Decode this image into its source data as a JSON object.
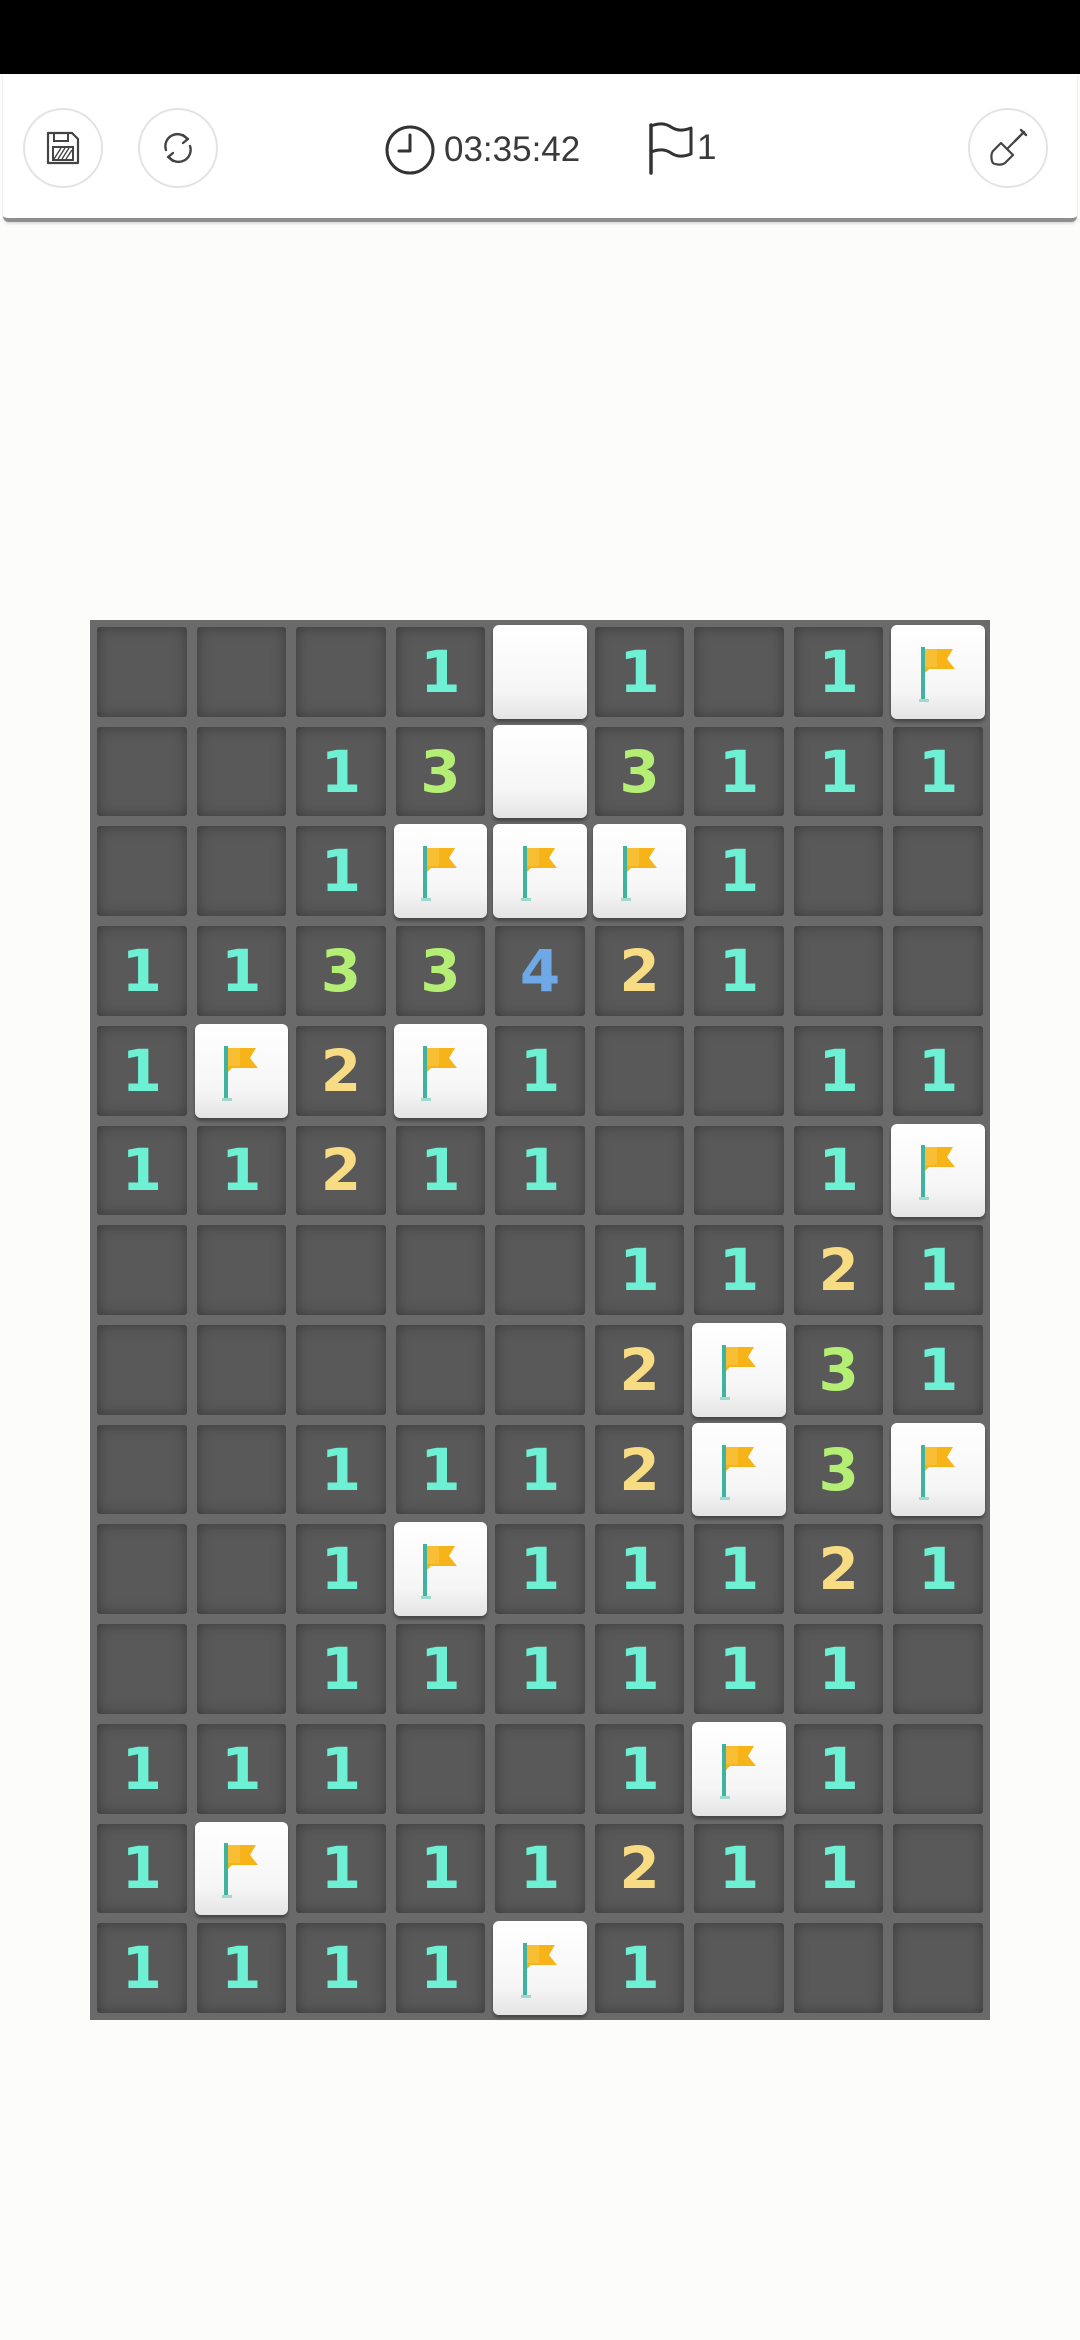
{
  "toolbar": {
    "save_icon": "save-icon",
    "restart_icon": "restart-icon",
    "timer_icon": "clock-icon",
    "timer": "03:35:42",
    "flag_icon": "flag-outline-icon",
    "flags_remaining": "1",
    "mode_icon": "shovel-icon"
  },
  "colors": {
    "n1": "#6ef0d4",
    "n2": "#f7dc84",
    "n3": "#b4ee74",
    "n4": "#6fa8e6",
    "flag": "#f7b418",
    "pole": "#3fb3a0"
  },
  "board": {
    "rows": [
      [
        "",
        "",
        "",
        "1",
        "C",
        "1",
        "",
        "1",
        "F"
      ],
      [
        "",
        "",
        "1",
        "3",
        "C",
        "3",
        "1",
        "1",
        "1"
      ],
      [
        "",
        "",
        "1",
        "F",
        "F",
        "F",
        "1",
        "",
        ""
      ],
      [
        "1",
        "1",
        "3",
        "3",
        "4",
        "2",
        "1",
        "",
        ""
      ],
      [
        "1",
        "F",
        "2",
        "F",
        "1",
        "",
        "",
        "1",
        "1"
      ],
      [
        "1",
        "1",
        "2",
        "1",
        "1",
        "",
        "",
        "1",
        "F"
      ],
      [
        "",
        "",
        "",
        "",
        "",
        "1",
        "1",
        "2",
        "1"
      ],
      [
        "",
        "",
        "",
        "",
        "",
        "2",
        "F",
        "3",
        "1"
      ],
      [
        "",
        "",
        "1",
        "1",
        "1",
        "2",
        "F",
        "3",
        "F"
      ],
      [
        "",
        "",
        "1",
        "F",
        "1",
        "1",
        "1",
        "2",
        "1"
      ],
      [
        "",
        "",
        "1",
        "1",
        "1",
        "1",
        "1",
        "1",
        ""
      ],
      [
        "1",
        "1",
        "1",
        "",
        "",
        "1",
        "F",
        "1",
        ""
      ],
      [
        "1",
        "F",
        "1",
        "1",
        "1",
        "2",
        "1",
        "1",
        ""
      ],
      [
        "1",
        "1",
        "1",
        "1",
        "F",
        "1",
        "",
        "",
        ""
      ]
    ]
  }
}
